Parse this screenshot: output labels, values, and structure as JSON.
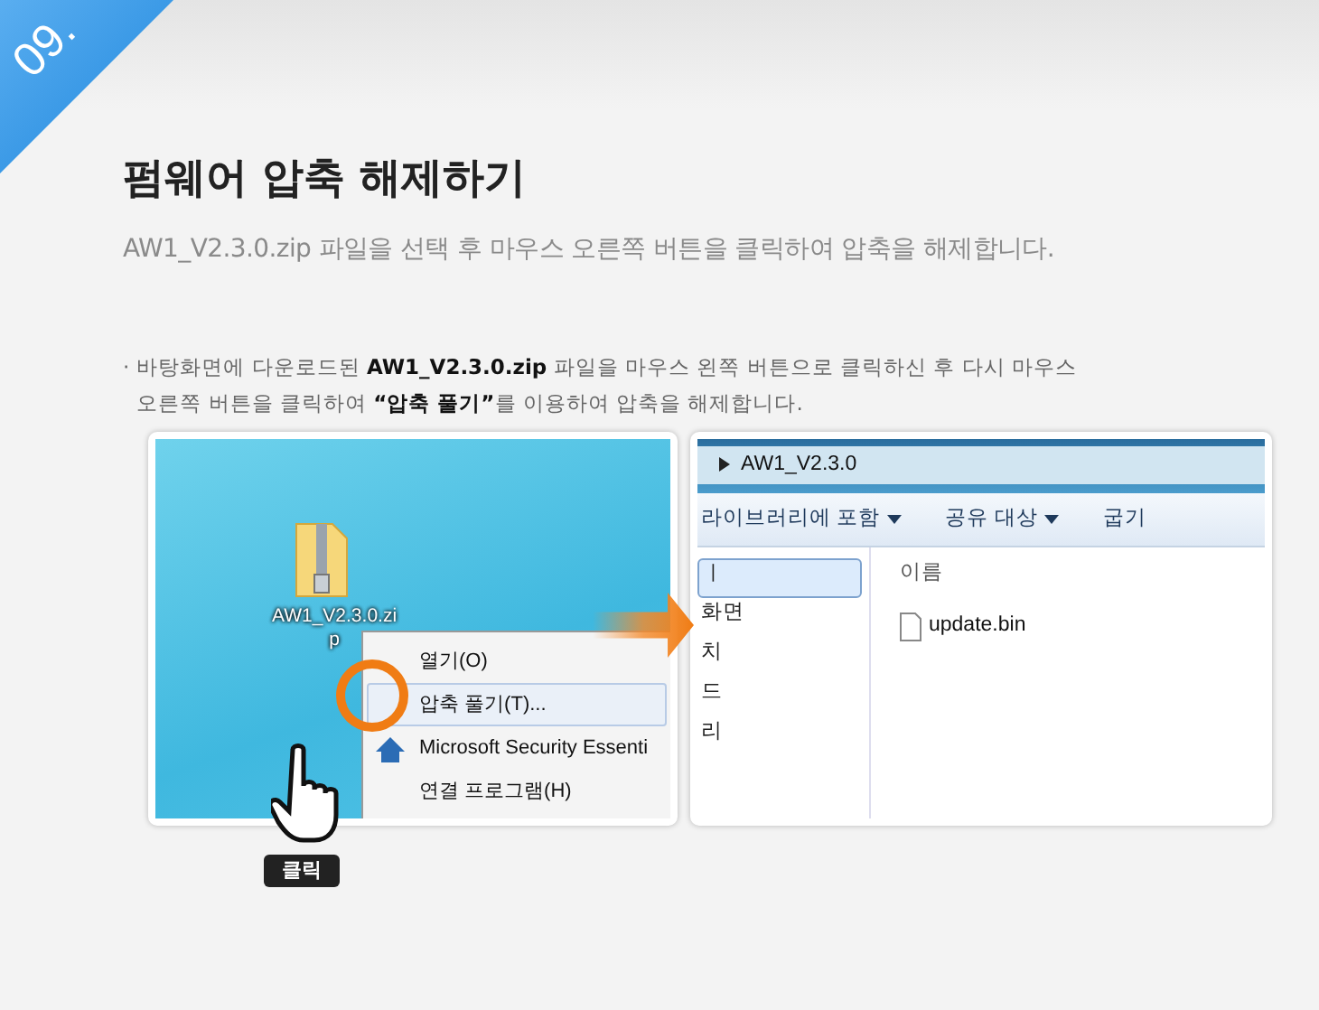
{
  "step_badge": "09.",
  "title": "펌웨어 압축 해제하기",
  "subtitle": "AW1_V2.3.0.zip 파일을 선택 후 마우스 오른쪽 버튼을 클릭하여 압축을 해제합니다.",
  "bullet": "·",
  "instruction": "바탕화면에 다운로드된 **AW1_V2.3.0.zip** 파일을 마우스 왼쪽 버튼으로 클릭하신 후 다시 마우스 오른쪽 버튼을 클릭하여 **“압축 풀기”**를 이용하여 압축을 해제합니다.",
  "desktop": {
    "file_label": "AW1_V2.3.0.zip",
    "context_menu": [
      {
        "label": "열기(O)",
        "selected": false,
        "kind": "plain"
      },
      {
        "label": "압축 풀기(T)...",
        "selected": true,
        "kind": "plain"
      },
      {
        "label": "Microsoft Security Essenti",
        "selected": false,
        "kind": "shield"
      },
      {
        "label": "연결 프로그램(H)",
        "selected": false,
        "kind": "plain"
      }
    ],
    "click_label": "클릭"
  },
  "explorer": {
    "breadcrumb": "AW1_V2.3.0",
    "toolbar": [
      {
        "label": "라이브러리에 포함",
        "dropdown": true
      },
      {
        "label": "공유 대상",
        "dropdown": true
      },
      {
        "label": "굽기",
        "dropdown": false
      }
    ],
    "nav_items": [
      {
        "label": "ㅣ",
        "selected": true
      },
      {
        "label": "화면",
        "selected": false
      },
      {
        "label": "치",
        "selected": false
      },
      {
        "label": "드",
        "selected": false
      },
      {
        "label": "리",
        "selected": false
      }
    ],
    "column_header": "이름",
    "files": [
      "update.bin"
    ]
  }
}
